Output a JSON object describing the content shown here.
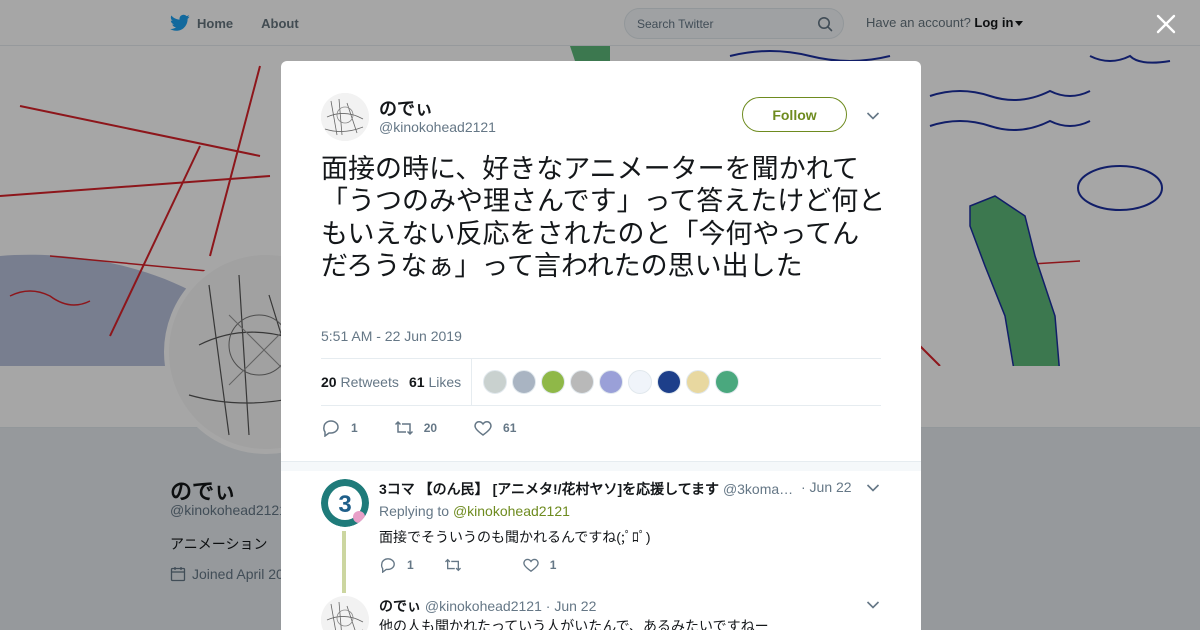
{
  "nav": {
    "home_label": "Home",
    "about_label": "About",
    "search_placeholder": "Search Twitter",
    "account_prompt": "Have an account?",
    "login_label": "Log in"
  },
  "profile": {
    "name": "のでぃ",
    "handle": "@kinokohead2121",
    "bio": "アニメーション",
    "joined": "Joined April 20"
  },
  "tweet": {
    "author_name": "のでぃ",
    "author_handle": "@kinokohead2121",
    "follow_label": "Follow",
    "text": "面接の時に、好きなアニメーターを聞かれて「うつのみや理さんです」って答えたけど何ともいえない反応をされたのと「今何やってんだろうなぁ」って言われたの思い出した",
    "timestamp": "5:51 AM - 22 Jun 2019",
    "retweets_count": "20",
    "retweets_label": "Retweets",
    "likes_count": "61",
    "likes_label": "Likes",
    "likers": [
      "#c9d1cf",
      "#a9b4c2",
      "#8fb848",
      "#b9b9b9",
      "#9aa0d8",
      "#f0f4fa",
      "#1d3f8a",
      "#e8d8a0",
      "#4aa87e"
    ],
    "actions": {
      "replies": "1",
      "retweets": "20",
      "likes": "61"
    }
  },
  "replies": [
    {
      "author_name": "3コマ 【のん民】 [アニメタ!/花村ヤソ]を応援してます",
      "author_handle": "@3koma…",
      "date": "· Jun 22",
      "replying_prefix": "Replying to",
      "replying_to": "@kinokohead2121",
      "text": "面接でそういうのも聞かれるんですね(;ﾟﾛﾟ)",
      "actions": {
        "replies": "1",
        "retweets": "",
        "likes": "1"
      }
    },
    {
      "author_name": "のでぃ",
      "author_handle": "@kinokohead2121",
      "date": "· Jun 22",
      "text": "他の人も聞かれたっていう人がいたんで、あるみたいですねー"
    }
  ],
  "colors": {
    "accent": "#6e8b1f",
    "twitter_blue": "#1da1f2",
    "muted": "#657786"
  },
  "icons": [
    "twitter-bird-icon",
    "search-icon",
    "close-icon",
    "chevron-down-icon",
    "reply-icon",
    "retweet-icon",
    "heart-icon",
    "calendar-icon"
  ]
}
